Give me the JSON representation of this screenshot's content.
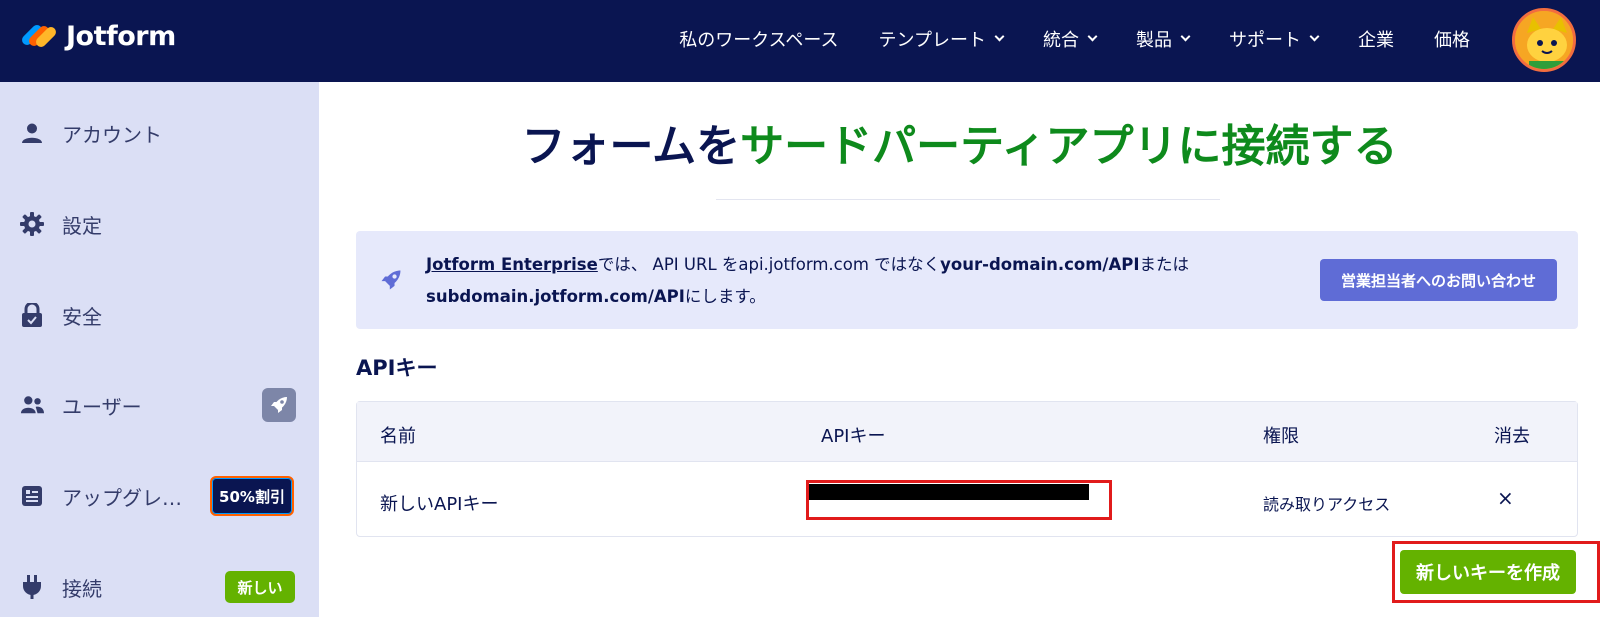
{
  "brand": {
    "name": "Jotform"
  },
  "nav": {
    "items": [
      {
        "label": "私のワークスペース",
        "dropdown": false
      },
      {
        "label": "テンプレート",
        "dropdown": true
      },
      {
        "label": "統合",
        "dropdown": true
      },
      {
        "label": "製品",
        "dropdown": true
      },
      {
        "label": "サポート",
        "dropdown": true
      },
      {
        "label": "企業",
        "dropdown": false
      },
      {
        "label": "価格",
        "dropdown": false
      }
    ]
  },
  "sidebar": {
    "items": [
      {
        "label": "アカウント",
        "icon": "user-icon"
      },
      {
        "label": "設定",
        "icon": "gear-icon"
      },
      {
        "label": "安全",
        "icon": "lock-icon"
      },
      {
        "label": "ユーザー",
        "icon": "users-icon"
      },
      {
        "label": "アップグレ…",
        "icon": "invoice-icon",
        "badge": "50%割引"
      },
      {
        "label": "接続",
        "icon": "plug-icon",
        "badge": "新しい"
      }
    ]
  },
  "main": {
    "title_part1": "フォームを",
    "title_part2": "サードパーティアプリに接続する",
    "notice": {
      "link": "Jotform Enterprise",
      "text1": "では、 API URL をapi.jotform.com ではなく",
      "bold1": "your-domain.com/API",
      "text2": "または",
      "bold2": "subdomain.jotform.com/API",
      "text3": "にします。",
      "button": "営業担当者へのお問い合わせ"
    },
    "section_title": "APIキー",
    "table": {
      "headers": [
        "名前",
        "APIキー",
        "権限",
        "消去"
      ],
      "rows": [
        {
          "name": "新しいAPIキー",
          "permission": "読み取りアクセス",
          "delete": "×"
        }
      ]
    },
    "create_button": "新しいキーを作成"
  },
  "colors": {
    "navy": "#0a1551",
    "green_title": "#0e8a1c",
    "green_button": "#64b200",
    "sidebar_bg": "#dbdff5",
    "notice_bg": "#e6e9fb",
    "accent_button": "#5f6cd6",
    "highlight_red": "#e11b1b"
  }
}
